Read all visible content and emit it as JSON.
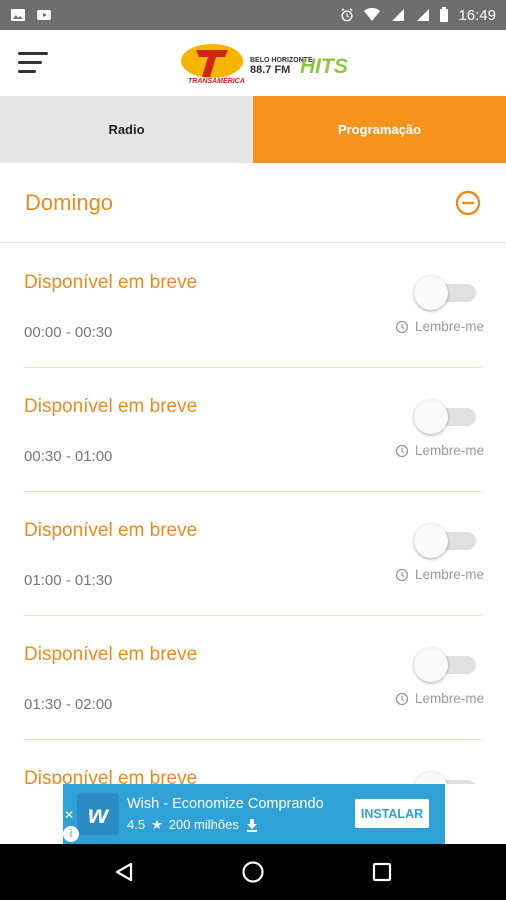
{
  "status_bar": {
    "time": "16:49",
    "left_icons": [
      "image-icon",
      "youtube-icon"
    ],
    "right_icons": [
      "alarm-icon",
      "wifi-icon",
      "signal-icon",
      "signal-icon",
      "battery-icon"
    ]
  },
  "app": {
    "logo_text_top": "BELO HORIZONTE",
    "logo_text_freq": "88.7 FM",
    "logo_text_hits": "HITS",
    "logo_text_brand": "TRANSAMÉRICA"
  },
  "tabs": [
    {
      "label": "Radio",
      "active": false
    },
    {
      "label": "Programação",
      "active": true
    }
  ],
  "day": {
    "title": "Domingo"
  },
  "schedule": [
    {
      "title": "Disponível em breve",
      "time": "00:00 - 00:30",
      "remind_label": "Lembre-me"
    },
    {
      "title": "Disponível em breve",
      "time": "00:30 - 01:00",
      "remind_label": "Lembre-me"
    },
    {
      "title": "Disponível em breve",
      "time": "01:00 - 01:30",
      "remind_label": "Lembre-me"
    },
    {
      "title": "Disponível em breve",
      "time": "01:30 - 02:00",
      "remind_label": "Lembre-me"
    },
    {
      "title": "Disponível em breve",
      "time": "",
      "remind_label": ""
    }
  ],
  "ad": {
    "title": "Wish - Economize Comprando",
    "rating": "4.5",
    "downloads": "200 milhões",
    "button_label": "INSTALAR",
    "logo_letter": "w"
  },
  "colors": {
    "accent": "#f7941d",
    "title_orange": "#f08a1c",
    "ad_blue": "#2fa1d6"
  }
}
